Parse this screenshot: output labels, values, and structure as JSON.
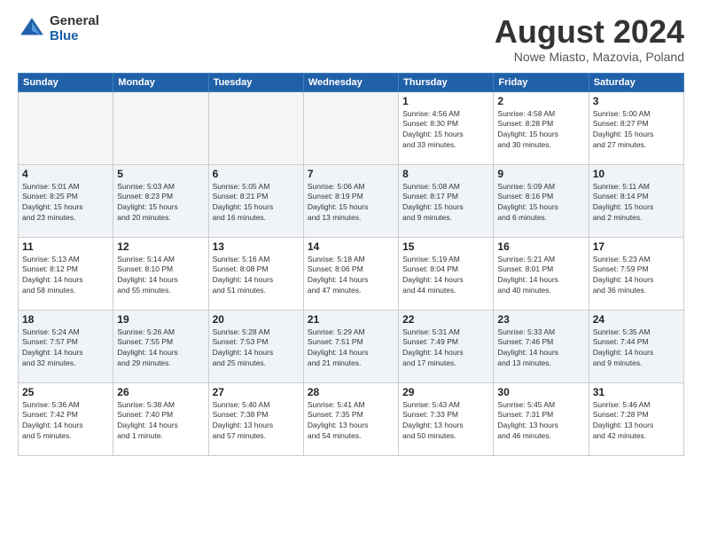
{
  "header": {
    "logo_general": "General",
    "logo_blue": "Blue",
    "main_title": "August 2024",
    "subtitle": "Nowe Miasto, Mazovia, Poland"
  },
  "weekdays": [
    "Sunday",
    "Monday",
    "Tuesday",
    "Wednesday",
    "Thursday",
    "Friday",
    "Saturday"
  ],
  "weeks": [
    [
      {
        "day": "",
        "info": ""
      },
      {
        "day": "",
        "info": ""
      },
      {
        "day": "",
        "info": ""
      },
      {
        "day": "",
        "info": ""
      },
      {
        "day": "1",
        "info": "Sunrise: 4:56 AM\nSunset: 8:30 PM\nDaylight: 15 hours\nand 33 minutes."
      },
      {
        "day": "2",
        "info": "Sunrise: 4:58 AM\nSunset: 8:28 PM\nDaylight: 15 hours\nand 30 minutes."
      },
      {
        "day": "3",
        "info": "Sunrise: 5:00 AM\nSunset: 8:27 PM\nDaylight: 15 hours\nand 27 minutes."
      }
    ],
    [
      {
        "day": "4",
        "info": "Sunrise: 5:01 AM\nSunset: 8:25 PM\nDaylight: 15 hours\nand 23 minutes."
      },
      {
        "day": "5",
        "info": "Sunrise: 5:03 AM\nSunset: 8:23 PM\nDaylight: 15 hours\nand 20 minutes."
      },
      {
        "day": "6",
        "info": "Sunrise: 5:05 AM\nSunset: 8:21 PM\nDaylight: 15 hours\nand 16 minutes."
      },
      {
        "day": "7",
        "info": "Sunrise: 5:06 AM\nSunset: 8:19 PM\nDaylight: 15 hours\nand 13 minutes."
      },
      {
        "day": "8",
        "info": "Sunrise: 5:08 AM\nSunset: 8:17 PM\nDaylight: 15 hours\nand 9 minutes."
      },
      {
        "day": "9",
        "info": "Sunrise: 5:09 AM\nSunset: 8:16 PM\nDaylight: 15 hours\nand 6 minutes."
      },
      {
        "day": "10",
        "info": "Sunrise: 5:11 AM\nSunset: 8:14 PM\nDaylight: 15 hours\nand 2 minutes."
      }
    ],
    [
      {
        "day": "11",
        "info": "Sunrise: 5:13 AM\nSunset: 8:12 PM\nDaylight: 14 hours\nand 58 minutes."
      },
      {
        "day": "12",
        "info": "Sunrise: 5:14 AM\nSunset: 8:10 PM\nDaylight: 14 hours\nand 55 minutes."
      },
      {
        "day": "13",
        "info": "Sunrise: 5:16 AM\nSunset: 8:08 PM\nDaylight: 14 hours\nand 51 minutes."
      },
      {
        "day": "14",
        "info": "Sunrise: 5:18 AM\nSunset: 8:06 PM\nDaylight: 14 hours\nand 47 minutes."
      },
      {
        "day": "15",
        "info": "Sunrise: 5:19 AM\nSunset: 8:04 PM\nDaylight: 14 hours\nand 44 minutes."
      },
      {
        "day": "16",
        "info": "Sunrise: 5:21 AM\nSunset: 8:01 PM\nDaylight: 14 hours\nand 40 minutes."
      },
      {
        "day": "17",
        "info": "Sunrise: 5:23 AM\nSunset: 7:59 PM\nDaylight: 14 hours\nand 36 minutes."
      }
    ],
    [
      {
        "day": "18",
        "info": "Sunrise: 5:24 AM\nSunset: 7:57 PM\nDaylight: 14 hours\nand 32 minutes."
      },
      {
        "day": "19",
        "info": "Sunrise: 5:26 AM\nSunset: 7:55 PM\nDaylight: 14 hours\nand 29 minutes."
      },
      {
        "day": "20",
        "info": "Sunrise: 5:28 AM\nSunset: 7:53 PM\nDaylight: 14 hours\nand 25 minutes."
      },
      {
        "day": "21",
        "info": "Sunrise: 5:29 AM\nSunset: 7:51 PM\nDaylight: 14 hours\nand 21 minutes."
      },
      {
        "day": "22",
        "info": "Sunrise: 5:31 AM\nSunset: 7:49 PM\nDaylight: 14 hours\nand 17 minutes."
      },
      {
        "day": "23",
        "info": "Sunrise: 5:33 AM\nSunset: 7:46 PM\nDaylight: 14 hours\nand 13 minutes."
      },
      {
        "day": "24",
        "info": "Sunrise: 5:35 AM\nSunset: 7:44 PM\nDaylight: 14 hours\nand 9 minutes."
      }
    ],
    [
      {
        "day": "25",
        "info": "Sunrise: 5:36 AM\nSunset: 7:42 PM\nDaylight: 14 hours\nand 5 minutes."
      },
      {
        "day": "26",
        "info": "Sunrise: 5:38 AM\nSunset: 7:40 PM\nDaylight: 14 hours\nand 1 minute."
      },
      {
        "day": "27",
        "info": "Sunrise: 5:40 AM\nSunset: 7:38 PM\nDaylight: 13 hours\nand 57 minutes."
      },
      {
        "day": "28",
        "info": "Sunrise: 5:41 AM\nSunset: 7:35 PM\nDaylight: 13 hours\nand 54 minutes."
      },
      {
        "day": "29",
        "info": "Sunrise: 5:43 AM\nSunset: 7:33 PM\nDaylight: 13 hours\nand 50 minutes."
      },
      {
        "day": "30",
        "info": "Sunrise: 5:45 AM\nSunset: 7:31 PM\nDaylight: 13 hours\nand 46 minutes."
      },
      {
        "day": "31",
        "info": "Sunrise: 5:46 AM\nSunset: 7:28 PM\nDaylight: 13 hours\nand 42 minutes."
      }
    ]
  ]
}
